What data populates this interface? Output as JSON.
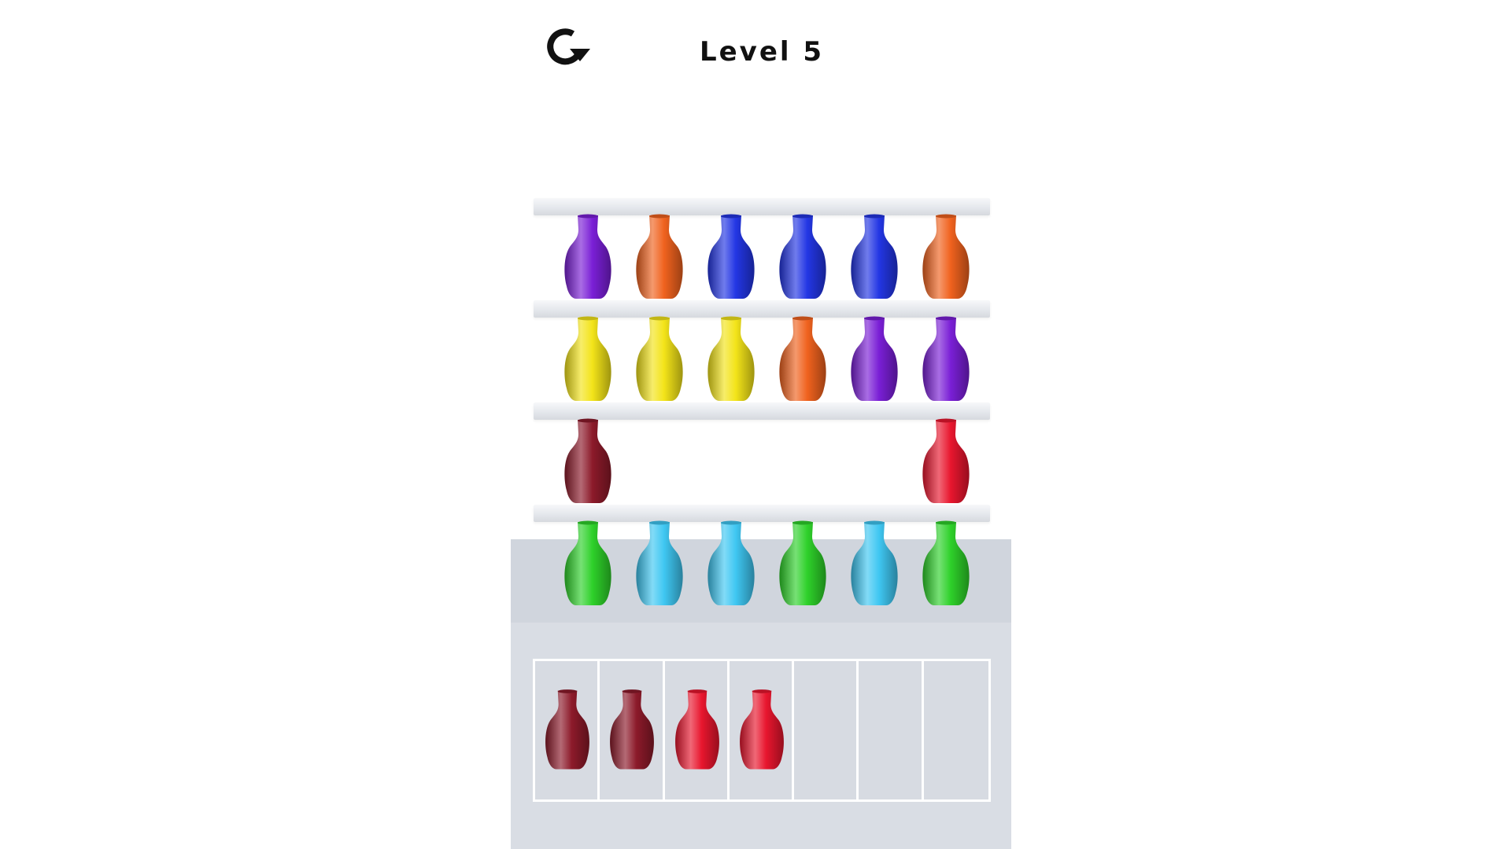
{
  "header": {
    "level_label": "Level 5",
    "restart_icon": "restart-icon"
  },
  "colors": {
    "purple": "#7a1fd6",
    "orange": "#f0621e",
    "blue": "#2336e4",
    "yellow": "#f3e419",
    "maroon": "#8c1a2a",
    "red": "#e8162e",
    "green": "#2ed12a",
    "cyan": "#3fc7f2"
  },
  "shelves": [
    {
      "vases": [
        "purple",
        "orange",
        "blue",
        "blue",
        "blue",
        "orange"
      ]
    },
    {
      "vases": [
        "yellow",
        "yellow",
        "yellow",
        "orange",
        "purple",
        "purple"
      ]
    },
    {
      "vases": [
        "maroon",
        null,
        null,
        null,
        null,
        "red"
      ]
    },
    {
      "vases": [
        "green",
        "cyan",
        "cyan",
        "green",
        "cyan",
        "green"
      ]
    }
  ],
  "tray": {
    "slot_count": 7,
    "vases": [
      "maroon",
      "maroon",
      "red",
      "red",
      null,
      null,
      null
    ]
  }
}
